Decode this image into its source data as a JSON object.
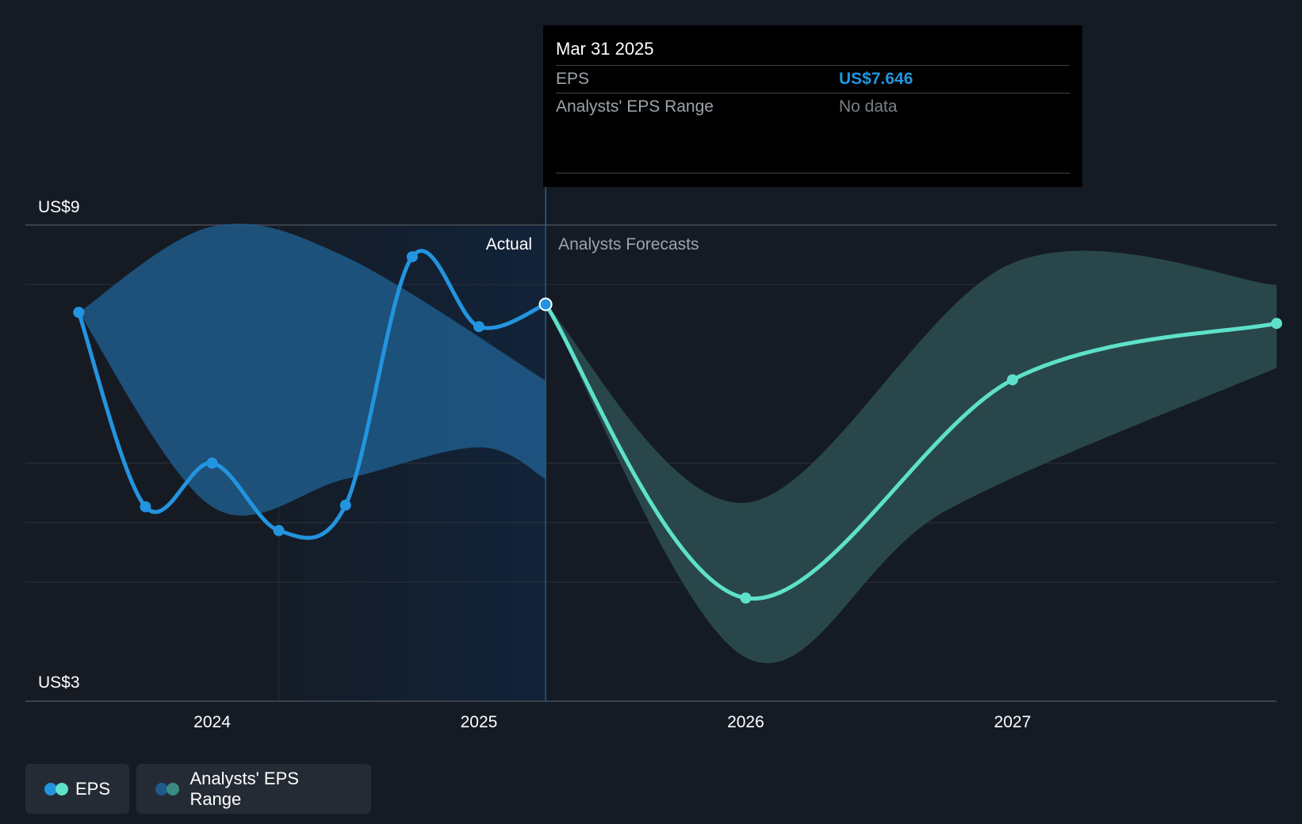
{
  "chart_data": {
    "type": "line",
    "x_axis": {
      "tick_labels": [
        "2024",
        "2025",
        "2026",
        "2027"
      ],
      "range": [
        2023.3,
        2027.99
      ]
    },
    "y_axis": {
      "tick_labels": [
        "US$9",
        "US$3"
      ],
      "range": [
        3,
        9
      ],
      "grid": true
    },
    "regions": {
      "actual_label": "Actual",
      "forecast_label": "Analysts Forecasts",
      "divider_x": 2025.25,
      "highlight_start_x": 2024.25
    },
    "series": [
      {
        "name": "EPS",
        "kind": "actual",
        "color": "#2394df",
        "points": [
          [
            2023.5,
            7.9
          ],
          [
            2023.75,
            5.45
          ],
          [
            2024.0,
            6.0
          ],
          [
            2024.25,
            5.15
          ],
          [
            2024.5,
            5.47
          ],
          [
            2024.75,
            8.6
          ],
          [
            2025.0,
            7.72
          ],
          [
            2025.25,
            8.0
          ]
        ]
      },
      {
        "name": "EPS",
        "kind": "forecast",
        "color": "#5ee1c9",
        "points": [
          [
            2025.25,
            8.0
          ],
          [
            2026.0,
            4.3
          ],
          [
            2027.0,
            7.05
          ],
          [
            2027.99,
            7.76
          ]
        ]
      }
    ],
    "ranges": [
      {
        "name": "Analysts' EPS Range",
        "kind": "actual",
        "color": "#1f5a89",
        "upper": [
          [
            2023.5,
            7.9
          ],
          [
            2024.0,
            8.98
          ],
          [
            2024.5,
            8.6
          ],
          [
            2025.25,
            7.04
          ]
        ],
        "lower": [
          [
            2023.5,
            7.9
          ],
          [
            2024.0,
            5.45
          ],
          [
            2024.5,
            5.8
          ],
          [
            2025.0,
            6.2
          ],
          [
            2025.25,
            5.8
          ]
        ]
      },
      {
        "name": "Analysts' EPS Range",
        "kind": "forecast",
        "color": "#2a4a4d",
        "upper": [
          [
            2025.25,
            8.0
          ],
          [
            2026.0,
            5.5
          ],
          [
            2027.0,
            8.52
          ],
          [
            2027.99,
            8.24
          ]
        ],
        "lower": [
          [
            2025.25,
            8.0
          ],
          [
            2026.0,
            3.55
          ],
          [
            2026.75,
            5.4
          ],
          [
            2027.99,
            7.2
          ]
        ]
      }
    ],
    "selected_point": {
      "x": 2025.25,
      "y": 8.0
    },
    "tooltip": {
      "date": "Mar 31 2025",
      "rows": [
        {
          "label": "EPS",
          "value": "US$7.646"
        },
        {
          "label": "Analysts' EPS Range",
          "value": "No data"
        }
      ]
    },
    "legend": [
      {
        "label": "EPS",
        "colors": [
          "#2394df",
          "#5ee1c9"
        ]
      },
      {
        "label": "Analysts' EPS Range",
        "colors": [
          "#1f5a89",
          "#3a8c83"
        ]
      }
    ]
  }
}
